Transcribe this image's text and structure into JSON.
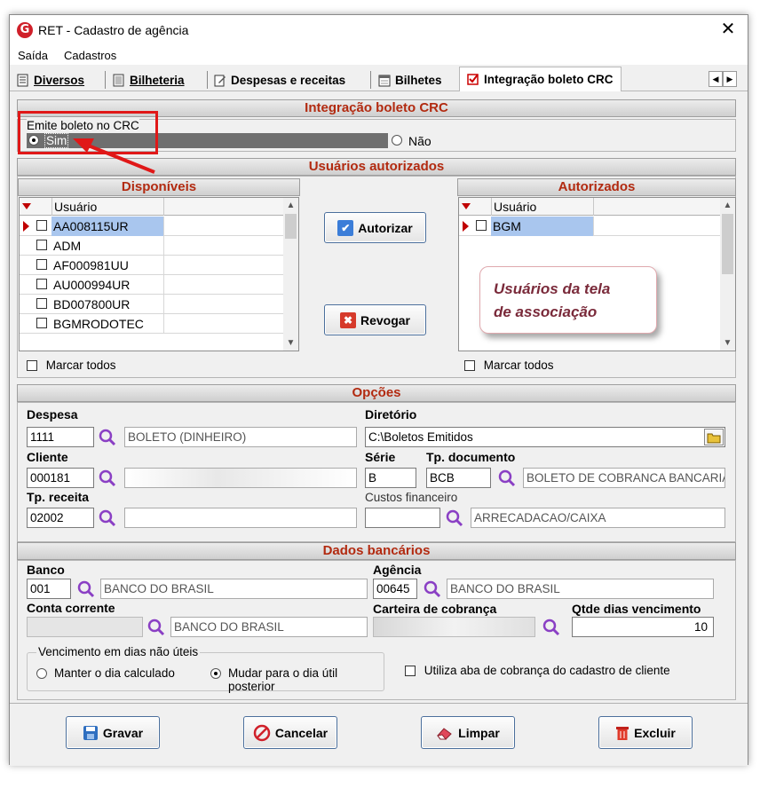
{
  "window": {
    "title": "RET - Cadastro de agência",
    "close_glyph": "✕",
    "app_icon_letter": "G"
  },
  "menu": [
    "Saída",
    "Cadastros"
  ],
  "tabs": [
    {
      "label": "Diversos",
      "icon": "document-icon"
    },
    {
      "label": "Bilheteria",
      "icon": "page-icon"
    },
    {
      "label": "Despesas e receitas",
      "icon": "edit-doc-icon"
    },
    {
      "label": "Bilhetes",
      "icon": "calendar-icon"
    },
    {
      "label": "Integração boleto CRC",
      "icon": "checkbox-icon",
      "active": true
    }
  ],
  "integration": {
    "header": "Integração boleto CRC",
    "group_label": "Emite boleto no CRC",
    "option_yes": "Sim",
    "option_no": "Não",
    "selected": "Sim"
  },
  "users": {
    "header": "Usuários autorizados",
    "available": {
      "header": "Disponíveis",
      "column": "Usuário",
      "rows": [
        "AA008115UR",
        "ADM",
        "AF000981UU",
        "AU000994UR",
        "BD007800UR",
        "BGMRODOTEC"
      ],
      "selected_index": 0,
      "mark_all": "Marcar todos"
    },
    "authorized": {
      "header": "Autorizados",
      "column": "Usuário",
      "rows": [
        "BGM"
      ],
      "selected_index": 0,
      "mark_all": "Marcar todos"
    },
    "authorize_button": "Autorizar",
    "revoke_button": "Revogar",
    "callout": [
      "Usuários da tela",
      "de associação"
    ]
  },
  "options": {
    "header": "Opções",
    "despesa": {
      "label": "Despesa",
      "code": "1111",
      "desc": "BOLETO (DINHEIRO)"
    },
    "diretorio": {
      "label": "Diretório",
      "value": "C:\\Boletos Emitidos"
    },
    "cliente": {
      "label": "Cliente",
      "code": "000181",
      "desc": ""
    },
    "serie": {
      "label": "Série",
      "value": "B"
    },
    "tp_documento": {
      "label": "Tp. documento",
      "code": "BCB",
      "desc": "BOLETO DE COBRANCA BANCARIA"
    },
    "tp_receita": {
      "label": "Tp. receita",
      "code": "02002",
      "desc": ""
    },
    "custos": {
      "label": "Custos financeiro",
      "code": "",
      "desc": "ARRECADACAO/CAIXA"
    }
  },
  "bank": {
    "header": "Dados bancários",
    "banco": {
      "label": "Banco",
      "code": "001",
      "desc": "BANCO DO BRASIL"
    },
    "agencia": {
      "label": "Agência",
      "code": "00645",
      "desc": "BANCO DO BRASIL"
    },
    "conta": {
      "label": "Conta corrente",
      "code": "",
      "desc": "BANCO DO BRASIL"
    },
    "carteira": {
      "label": "Carteira de cobrança",
      "value": ""
    },
    "qtde": {
      "label": "Qtde dias vencimento",
      "value": "10"
    },
    "vencimento": {
      "label": "Vencimento em dias não úteis",
      "option_keep": "Manter o dia calculado",
      "option_change": "Mudar para o dia útil posterior",
      "selected": "Mudar para o dia útil posterior"
    },
    "use_client_tab": "Utiliza aba de cobrança do cadastro de cliente"
  },
  "buttons": {
    "save": "Gravar",
    "cancel": "Cancelar",
    "clear": "Limpar",
    "delete": "Excluir"
  },
  "colors": {
    "section_title": "#b22a10",
    "selection": "#a9c6ee",
    "highlight": "#e01818",
    "callout_text": "#7a2a3a"
  }
}
